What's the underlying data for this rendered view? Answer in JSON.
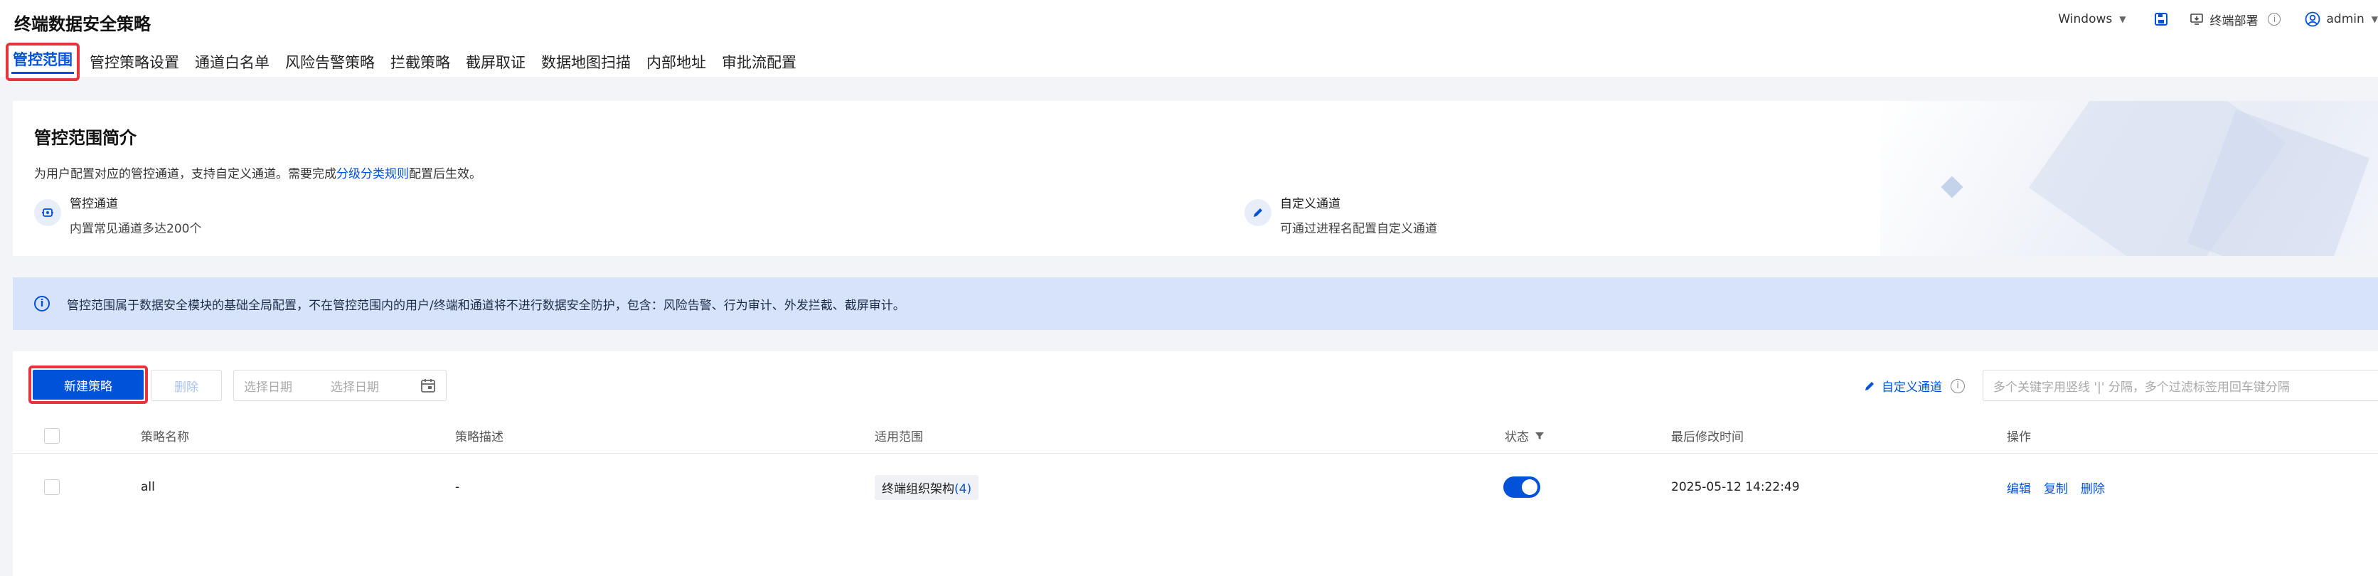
{
  "header": {
    "title": "终端数据安全策略",
    "os_selector": "Windows",
    "deploy_label": "终端部署",
    "user": "admin"
  },
  "tabs": [
    {
      "label": "管控范围",
      "active": true
    },
    {
      "label": "管控策略设置"
    },
    {
      "label": "通道白名单"
    },
    {
      "label": "风险告警策略"
    },
    {
      "label": "拦截策略"
    },
    {
      "label": "截屏取证"
    },
    {
      "label": "数据地图扫描"
    },
    {
      "label": "内部地址"
    },
    {
      "label": "审批流配置"
    }
  ],
  "intro": {
    "title": "管控范围简介",
    "desc_prefix": "为用户配置对应的管控通道，支持自定义通道。需要完成",
    "desc_link": "分级分类规则",
    "desc_suffix": "配置后生效。",
    "features": [
      {
        "title": "管控通道",
        "sub": "内置常见通道多达200个",
        "icon": "channel-icon"
      },
      {
        "title": "自定义通道",
        "sub": "可通过进程名配置自定义通道",
        "icon": "pencil-icon"
      }
    ]
  },
  "notice": {
    "text": "管控范围属于数据安全模块的基础全局配置，不在管控范围内的用户/终端和通道将不进行数据安全防护，包含：风险告警、行为审计、外发拦截、截屏审计。"
  },
  "toolbar": {
    "new_label": "新建策略",
    "delete_label": "删除",
    "date_start_placeholder": "选择日期",
    "date_end_placeholder": "选择日期",
    "custom_channel_label": "自定义通道",
    "search_placeholder": "多个关键字用竖线 '|' 分隔，多个过滤标签用回车键分隔"
  },
  "table": {
    "columns": [
      "策略名称",
      "策略描述",
      "适用范围",
      "状态",
      "最后修改时间",
      "操作"
    ],
    "rows": [
      {
        "name": "all",
        "desc": "-",
        "scope_label": "终端组织架构",
        "scope_count": "(4)",
        "enabled": true,
        "modified": "2025-05-12 14:22:49",
        "actions": [
          "编辑",
          "复制",
          "删除"
        ]
      }
    ]
  },
  "colors": {
    "primary": "#0052d9",
    "highlight_border": "#e8323c",
    "notice_bg": "#d6e3fb"
  }
}
